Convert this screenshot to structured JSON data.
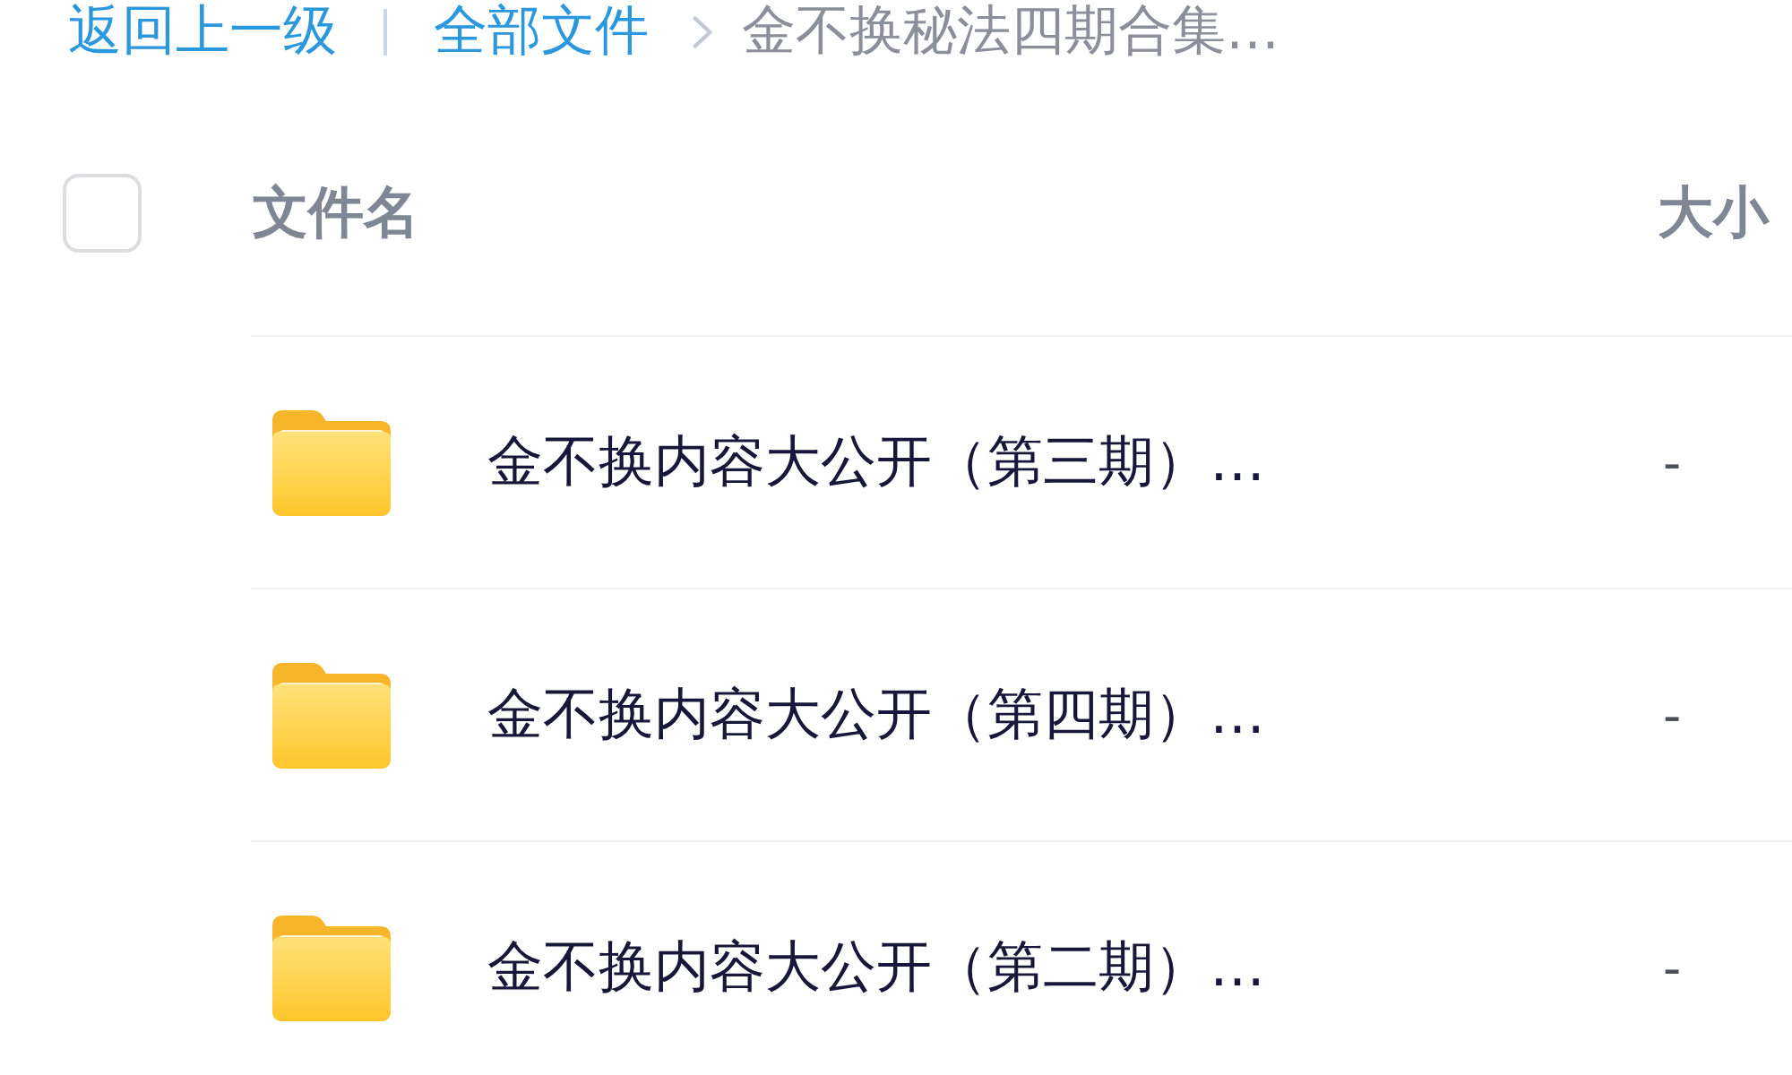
{
  "breadcrumb": {
    "back": "返回上一级",
    "items": [
      {
        "label": "全部文件",
        "kind": "link"
      },
      {
        "label": "金不换秘法四期合集…",
        "kind": "current"
      }
    ]
  },
  "table": {
    "select_all": {
      "checked": false
    },
    "columns": [
      "文件名",
      "大小"
    ],
    "rows": [
      {
        "kind": "folder",
        "name": "金不换内容大公开（第三期）…",
        "size": "-"
      },
      {
        "kind": "folder",
        "name": "金不换内容大公开（第四期）…",
        "size": "-"
      },
      {
        "kind": "folder",
        "name": "金不换内容大公开（第二期）…",
        "size": "-"
      }
    ]
  }
}
